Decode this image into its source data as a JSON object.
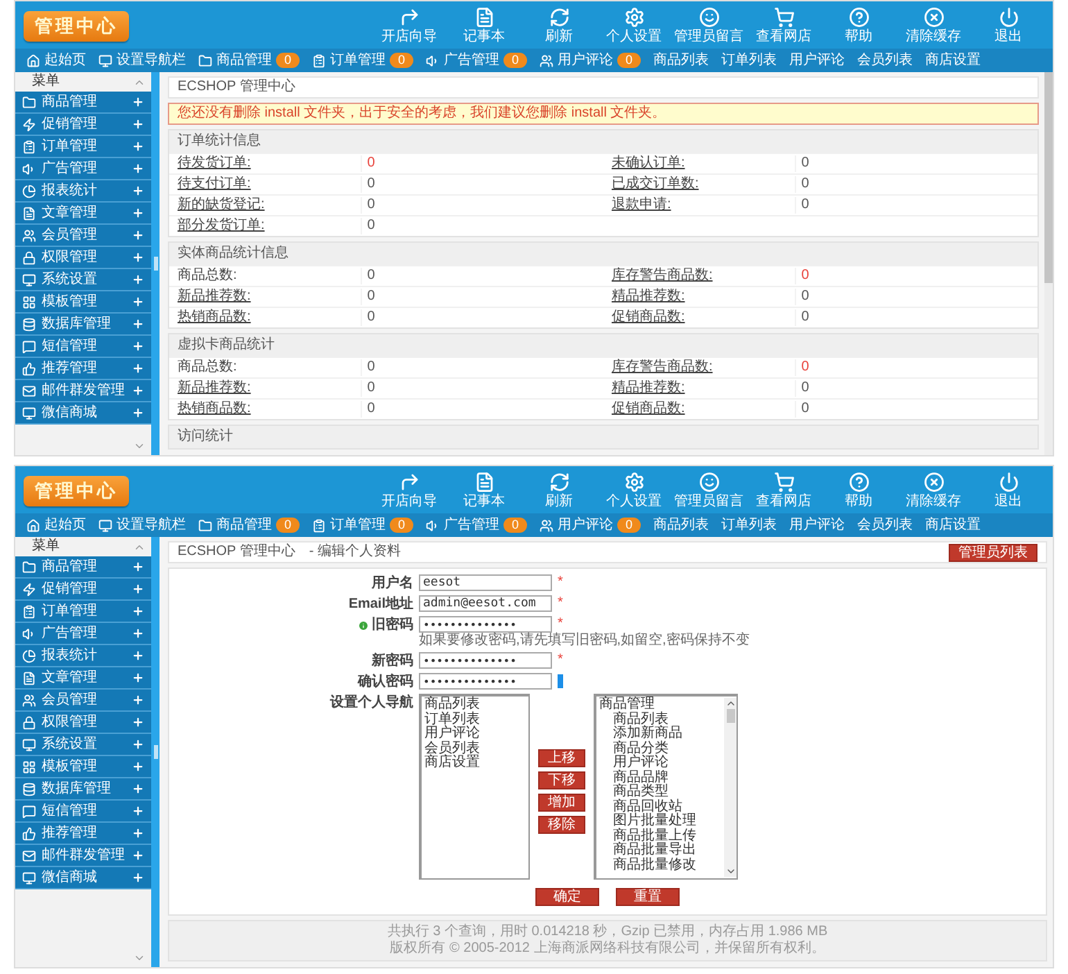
{
  "screens": [
    {
      "header": {
        "logo": "管理中心",
        "tools": [
          "开店向导",
          "记事本",
          "刷新",
          "个人设置",
          "管理员留言",
          "查看网店",
          "帮助",
          "清除缓存",
          "退出"
        ]
      },
      "nav": [
        {
          "label": "起始页"
        },
        {
          "label": "设置导航栏"
        },
        {
          "label": "商品管理",
          "badge": "0"
        },
        {
          "label": "订单管理",
          "badge": "0"
        },
        {
          "label": "广告管理",
          "badge": "0"
        },
        {
          "label": "用户评论",
          "badge": "0"
        },
        {
          "label": "商品列表"
        },
        {
          "label": "订单列表"
        },
        {
          "label": "用户评论"
        },
        {
          "label": "会员列表"
        },
        {
          "label": "商店设置"
        }
      ],
      "sidebar": {
        "title": "菜单",
        "items": [
          "商品管理",
          "促销管理",
          "订单管理",
          "广告管理",
          "报表统计",
          "文章管理",
          "会员管理",
          "权限管理",
          "系统设置",
          "模板管理",
          "数据库管理",
          "短信管理",
          "推荐管理",
          "邮件群发管理",
          "微信商城"
        ]
      },
      "breadcrumb": [
        "ECSHOP 管理中心"
      ],
      "notice": "您还没有删除 install 文件夹，出于安全的考虑，我们建议您删除 install 文件夹。",
      "sections": [
        {
          "title": "订单统计信息",
          "rows": [
            [
              {
                "label": "待发货订单:",
                "value": "0",
                "link": true,
                "warning": true
              },
              {
                "label": "未确认订单:",
                "value": "0",
                "link": true,
                "warning": false
              }
            ],
            [
              {
                "label": "待支付订单:",
                "value": "0",
                "link": true,
                "warning": false
              },
              {
                "label": "已成交订单数:",
                "value": "0",
                "link": true,
                "warning": false
              }
            ],
            [
              {
                "label": "新的缺货登记:",
                "value": "0",
                "link": true,
                "warning": false
              },
              {
                "label": "退款申请:",
                "value": "0",
                "link": true,
                "warning": false
              }
            ],
            [
              {
                "label": "部分发货订单:",
                "value": "0",
                "link": true,
                "warning": false
              }
            ]
          ]
        },
        {
          "title": "实体商品统计信息",
          "rows": [
            [
              {
                "label": "商品总数:",
                "value": "0",
                "link": false,
                "warning": false
              },
              {
                "label": "库存警告商品数:",
                "value": "0",
                "link": true,
                "warning": true
              }
            ],
            [
              {
                "label": "新品推荐数:",
                "value": "0",
                "link": true,
                "warning": false
              },
              {
                "label": "精品推荐数:",
                "value": "0",
                "link": true,
                "warning": false
              }
            ],
            [
              {
                "label": "热销商品数:",
                "value": "0",
                "link": true,
                "warning": false
              },
              {
                "label": "促销商品数:",
                "value": "0",
                "link": true,
                "warning": false
              }
            ]
          ]
        },
        {
          "title": "虚拟卡商品统计",
          "rows": [
            [
              {
                "label": "商品总数:",
                "value": "0",
                "link": false,
                "warning": false
              },
              {
                "label": "库存警告商品数:",
                "value": "0",
                "link": true,
                "warning": true
              }
            ],
            [
              {
                "label": "新品推荐数:",
                "value": "0",
                "link": true,
                "warning": false
              },
              {
                "label": "精品推荐数:",
                "value": "0",
                "link": true,
                "warning": false
              }
            ],
            [
              {
                "label": "热销商品数:",
                "value": "0",
                "link": true,
                "warning": false
              },
              {
                "label": "促销商品数:",
                "value": "0",
                "link": true,
                "warning": false
              }
            ]
          ]
        },
        {
          "title": "访问统计"
        }
      ]
    },
    {
      "header": {
        "logo": "管理中心",
        "tools": [
          "开店向导",
          "记事本",
          "刷新",
          "个人设置",
          "管理员留言",
          "查看网店",
          "帮助",
          "清除缓存",
          "退出"
        ]
      },
      "nav": [
        {
          "label": "起始页"
        },
        {
          "label": "设置导航栏"
        },
        {
          "label": "商品管理",
          "badge": "0"
        },
        {
          "label": "订单管理",
          "badge": "0"
        },
        {
          "label": "广告管理",
          "badge": "0"
        },
        {
          "label": "用户评论",
          "badge": "0"
        },
        {
          "label": "商品列表"
        },
        {
          "label": "订单列表"
        },
        {
          "label": "用户评论"
        },
        {
          "label": "会员列表"
        },
        {
          "label": "商店设置"
        }
      ],
      "sidebar": {
        "title": "菜单",
        "items": [
          "商品管理",
          "促销管理",
          "订单管理",
          "广告管理",
          "报表统计",
          "文章管理",
          "会员管理",
          "权限管理",
          "系统设置",
          "模板管理",
          "数据库管理",
          "短信管理",
          "推荐管理",
          "邮件群发管理",
          "微信商城"
        ]
      },
      "breadcrumb": [
        "ECSHOP 管理中心",
        "- 编辑个人资料"
      ],
      "action_button": "管理员列表",
      "form": {
        "fields": [
          {
            "kind": "text",
            "label": "用户名",
            "value": "eesot",
            "marker": "*"
          },
          {
            "kind": "text",
            "label": "Email地址",
            "value": "admin@eesot.com",
            "marker": "*"
          },
          {
            "kind": "password",
            "label": "旧密码",
            "value": "••••••••••••••",
            "marker": "*",
            "hint": "如果要修改密码,请先填写旧密码,如留空,密码保持不变"
          },
          {
            "kind": "password",
            "label": "新密码",
            "value": "••••••••••••••",
            "marker": "*"
          },
          {
            "kind": "password",
            "label": "确认密码",
            "value": "••••••••••••••"
          }
        ],
        "nav_setting": {
          "label": "设置个人导航",
          "current": [
            "商品列表",
            "订单列表",
            "用户评论",
            "会员列表",
            "商店设置"
          ],
          "buttons": [
            "上移",
            "下移",
            "增加",
            "移除"
          ],
          "available": [
            {
              "label": "商品管理",
              "children": [
                "商品列表",
                "添加新商品",
                "商品分类",
                "用户评论",
                "商品品牌",
                "商品类型",
                "商品回收站",
                "图片批量处理",
                "商品批量上传",
                "商品批量导出",
                "商品批量修改"
              ]
            }
          ]
        },
        "buttons": [
          "确定",
          "重置"
        ]
      },
      "footer": [
        "共执行 3 个查询，用时 0.014218 秒，Gzip 已禁用，内存占用 1.986 MB",
        "版权所有 © 2005-2012 上海商派网络科技有限公司，并保留所有权利。"
      ]
    }
  ]
}
